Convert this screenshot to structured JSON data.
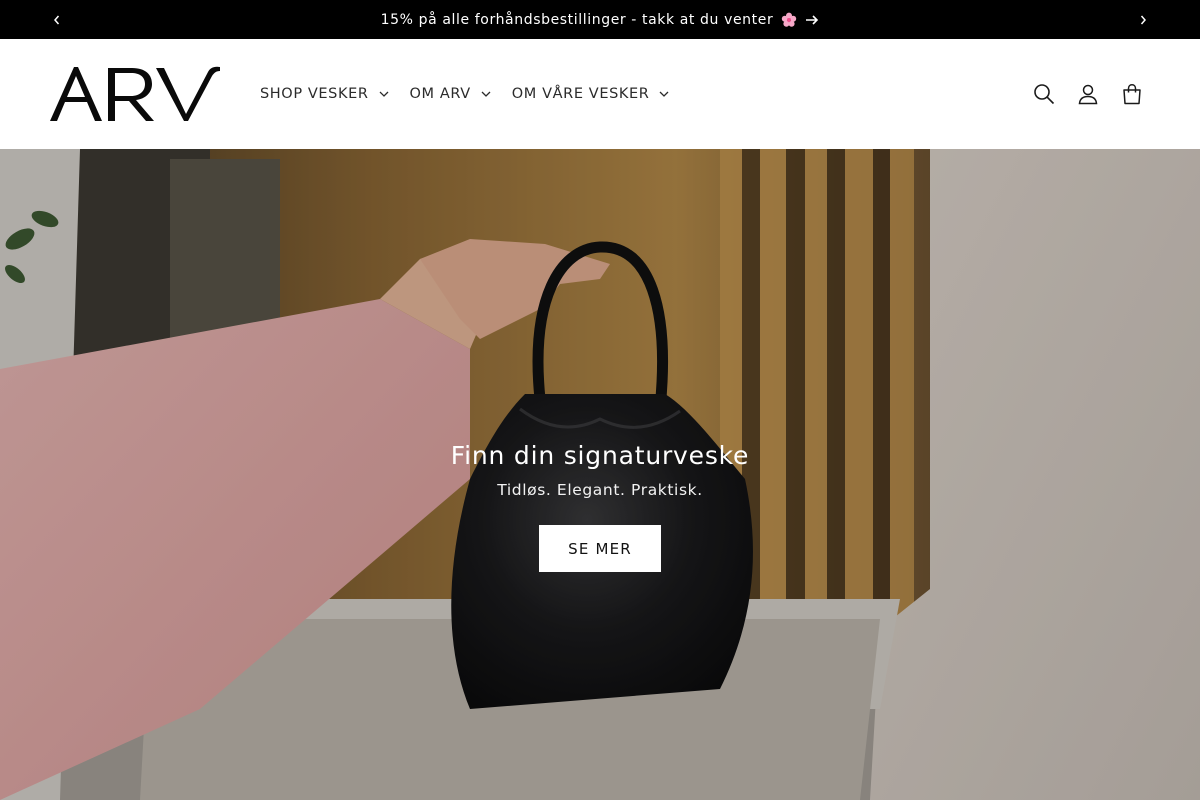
{
  "announcement": {
    "text": "15% på alle forhåndsbestillinger - takk at du venter",
    "prev_icon": "chevron-left-icon",
    "next_icon": "chevron-right-icon",
    "emoji_icon": "cherry-blossom-icon",
    "arrow_icon": "arrow-right-icon"
  },
  "header": {
    "logo_text": "ARV",
    "nav": [
      {
        "label": "SHOP VESKER"
      },
      {
        "label": "OM ARV"
      },
      {
        "label": "OM VÅRE VESKER"
      }
    ],
    "icons": [
      "search-icon",
      "account-icon",
      "cart-icon"
    ]
  },
  "hero": {
    "title": "Finn din signaturveske",
    "subtitle": "Tidløs. Elegant. Praktisk.",
    "button_label": "SE MER"
  },
  "colors": {
    "announcement_bg": "#000000",
    "header_bg": "#ffffff",
    "text": "#121212",
    "button_bg": "#ffffff"
  }
}
